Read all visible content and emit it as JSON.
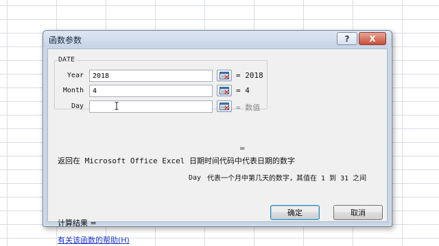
{
  "dialog": {
    "title": "函数参数",
    "help_button": "?",
    "close_button": "X"
  },
  "function": {
    "name": "DATE",
    "arguments": [
      {
        "label": "Year",
        "value": "2018",
        "result": "= 2018"
      },
      {
        "label": "Month",
        "value": "4",
        "result": "= 4"
      },
      {
        "label": "Day",
        "value": "",
        "result": "= 数值"
      }
    ],
    "result_eq": "=",
    "description": "返回在 Microsoft Office Excel 日期时间代码中代表日期的数字",
    "arg_desc_name": "Day",
    "arg_desc_text": "代表一个月中第几天的数字，其值在 1 到 31 之间"
  },
  "footer": {
    "calc_result": "计算结果 =",
    "help_link": "有关该函数的帮助(H)",
    "ok_label": "确定",
    "cancel_label": "取消"
  },
  "icons": {
    "ref": "collapse-dialog-icon",
    "cursor": "text-cursor-icon"
  },
  "colors": {
    "title_bar": "#c9d6e6",
    "link": "#1a33cc",
    "hint": "#8a8a8a"
  }
}
